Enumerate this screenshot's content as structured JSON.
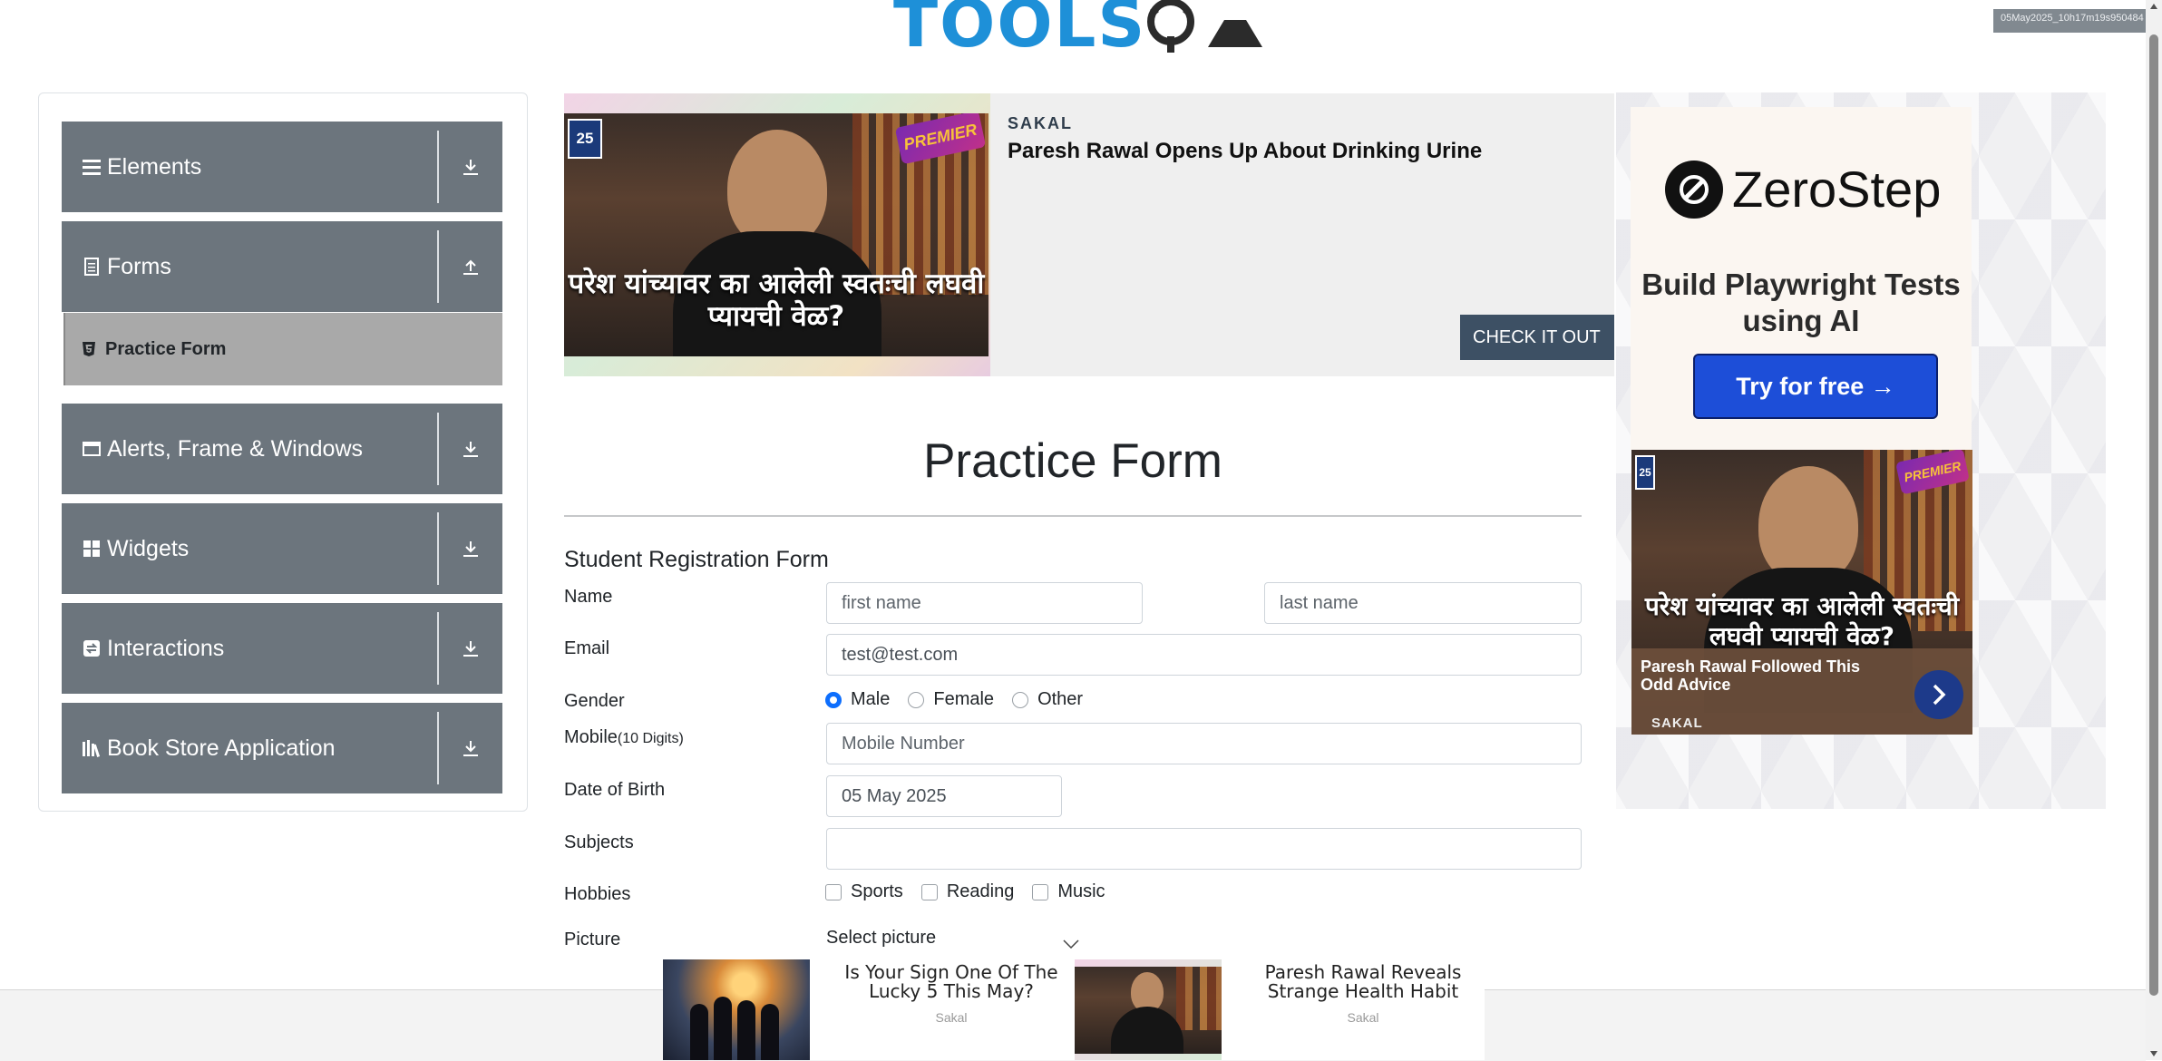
{
  "header": {
    "logo_text": "TOOLS",
    "logo_suffix": "QA",
    "watermark": "05May2025_10h17m19s950484"
  },
  "sidebar": {
    "groups": [
      {
        "label": "Elements",
        "icon": "hamburger-icon",
        "expanded": false
      },
      {
        "label": "Forms",
        "icon": "document-icon",
        "expanded": true
      },
      {
        "label": "Alerts, Frame & Windows",
        "icon": "window-icon",
        "expanded": false
      },
      {
        "label": "Widgets",
        "icon": "grid-icon",
        "expanded": false
      },
      {
        "label": "Interactions",
        "icon": "swap-icon",
        "expanded": false
      },
      {
        "label": "Book Store Application",
        "icon": "books-icon",
        "expanded": false
      }
    ],
    "active_item": "Practice Form"
  },
  "top_ad": {
    "source": "SAKAL",
    "headline": "Paresh Rawal Opens Up About Drinking Urine",
    "cta": "CHECK IT OUT",
    "image_caption": "परेश यांच्यावर का आलेली स्वतःची लघवी प्यायची वेळ?",
    "badge": "25",
    "premier": "PREMIER"
  },
  "right_ad": {
    "brand": "ZeroStep",
    "tagline": "Build Playwright Tests using AI",
    "button": "Try for free →",
    "news_title": "Paresh Rawal Followed This Odd Advice",
    "news_source": "SAKAL",
    "image_caption": "परेश यांच्यावर का आलेली स्वतःची लघवी प्यायची वेळ?",
    "badge": "25",
    "premier": "PREMIER"
  },
  "form": {
    "page_title": "Practice Form",
    "subtitle": "Student Registration Form",
    "name_label": "Name",
    "first_name_placeholder": "first name",
    "last_name_placeholder": "last name",
    "email_label": "Email",
    "email_value": "test@test.com",
    "gender_label": "Gender",
    "gender_options": [
      "Male",
      "Female",
      "Other"
    ],
    "gender_selected": "Male",
    "mobile_label": "Mobile",
    "mobile_hint": "(10 Digits)",
    "mobile_placeholder": "Mobile Number",
    "dob_label": "Date of Birth",
    "dob_value": "05 May 2025",
    "subjects_label": "Subjects",
    "subjects_value": "",
    "hobbies_label": "Hobbies",
    "hobbies": [
      "Sports",
      "Reading",
      "Music"
    ],
    "picture_label": "Picture",
    "picture_button": "Select picture"
  },
  "bottom_ads": [
    {
      "title": "Is Your Sign One Of The Lucky 5 This May?",
      "source": "Sakal"
    },
    {
      "title": "Paresh Rawal Reveals Strange Health Habit",
      "source": "Sakal"
    }
  ],
  "colors": {
    "sidebar_group": "#6c757d",
    "sidebar_active": "#a9a9a9",
    "accent": "#0d6efd",
    "logo": "#1e90d8"
  }
}
